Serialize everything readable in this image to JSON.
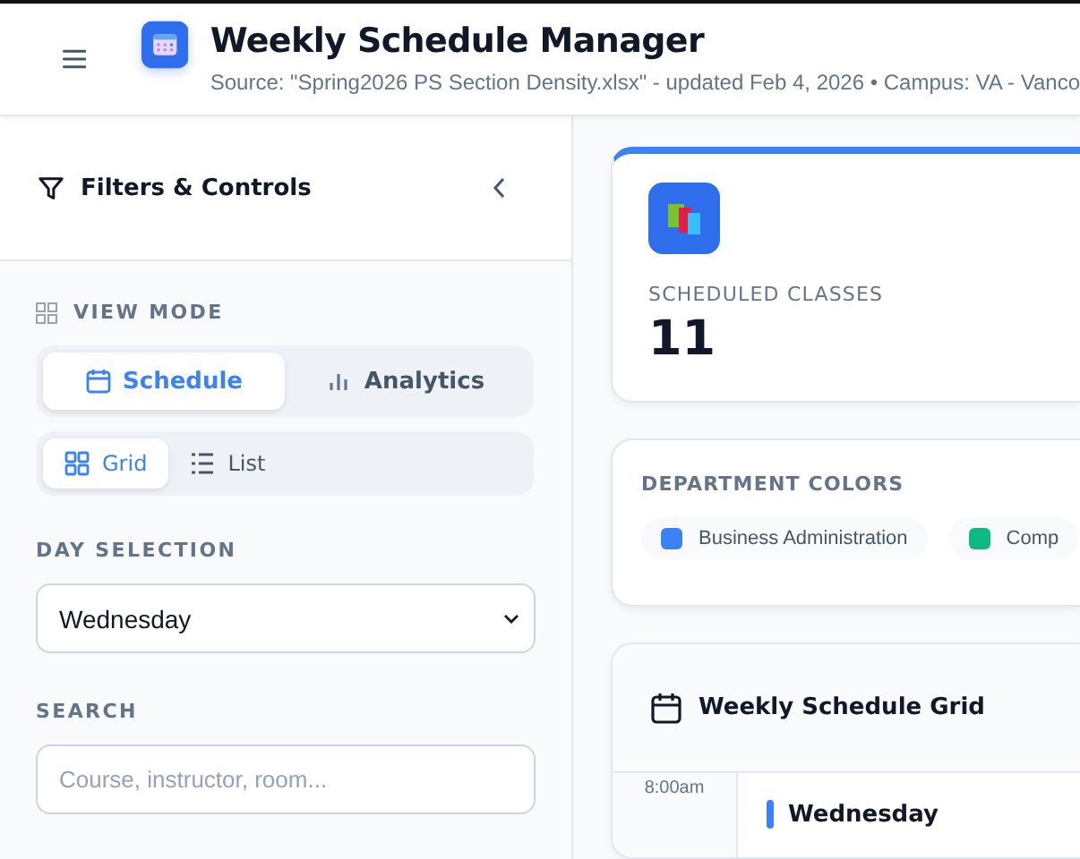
{
  "header": {
    "title": "Weekly Schedule Manager",
    "subtitle": "Source: \"Spring2026 PS Section Density.xlsx\" - updated Feb 4, 2026 • Campus: VA - Vanco"
  },
  "sidebar": {
    "title": "Filters & Controls",
    "view_mode": {
      "label": "VIEW MODE",
      "tabs": [
        {
          "label": "Schedule",
          "kind": "calendar",
          "selected": true
        },
        {
          "label": "Analytics",
          "kind": "chart",
          "selected": false
        }
      ],
      "layouts": [
        {
          "label": "Grid",
          "kind": "grid",
          "selected": true
        },
        {
          "label": "List",
          "kind": "list",
          "selected": false
        }
      ]
    },
    "day_selection": {
      "label": "DAY SELECTION",
      "value": "Wednesday"
    },
    "search": {
      "label": "SEARCH",
      "placeholder": "Course, instructor, room..."
    }
  },
  "stat": {
    "label": "SCHEDULED CLASSES",
    "value": "11"
  },
  "departments": {
    "label": "DEPARTMENT COLORS",
    "items": [
      {
        "name": "Business Administration",
        "color": "#3b82f6"
      },
      {
        "name": "Comp",
        "color": "#10b981"
      }
    ]
  },
  "grid": {
    "title": "Weekly Schedule Grid",
    "time": "8:00am",
    "day": "Wednesday"
  }
}
